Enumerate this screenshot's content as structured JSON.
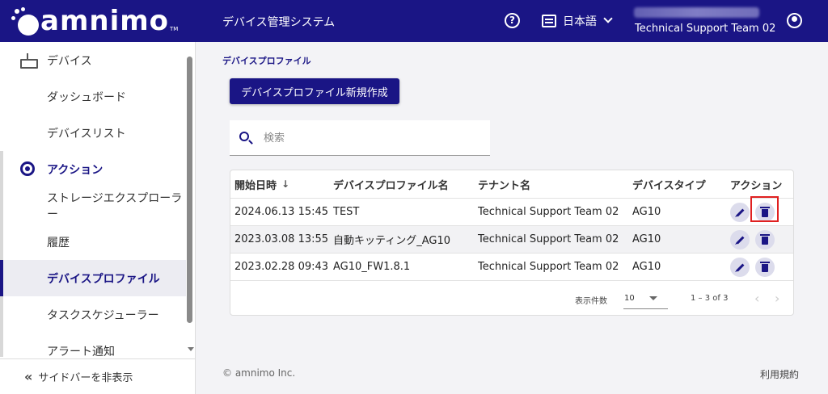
{
  "header": {
    "logo_text": "amnimo",
    "logo_tm": "TM",
    "app_title": "デバイス管理システム",
    "help_glyph": "?",
    "language": "日本語",
    "team_name": "Technical Support Team 02"
  },
  "sidebar": {
    "items": [
      {
        "label": "デバイス",
        "kind": "section-inactive",
        "icon": "router-icon"
      },
      {
        "label": "ダッシュボード",
        "kind": "sub"
      },
      {
        "label": "デバイスリスト",
        "kind": "sub"
      },
      {
        "label": "アクション",
        "kind": "section-active",
        "icon": "gear-icon"
      },
      {
        "label": "ストレージエクスプローラー",
        "kind": "sub"
      },
      {
        "label": "履歴",
        "kind": "sub"
      },
      {
        "label": "デバイスプロファイル",
        "kind": "active"
      },
      {
        "label": "タスクスケジューラー",
        "kind": "sub"
      },
      {
        "label": "アラート通知",
        "kind": "sub"
      }
    ],
    "collapse_icon": "«",
    "collapse_label": "サイドバーを非表示"
  },
  "main": {
    "breadcrumb": "デバイスプロファイル",
    "new_button_label": "デバイスプロファイル新規作成",
    "search": {
      "placeholder": "検索",
      "value": ""
    },
    "table": {
      "columns": [
        "開始日時",
        "デバイスプロファイル名",
        "テナント名",
        "デバイスタイプ",
        "アクション"
      ],
      "sort_indicator": "↓",
      "rows": [
        {
          "start": "2024.06.13 15:45",
          "name": "TEST",
          "tenant": "Technical Support Team 02",
          "type": "AG10"
        },
        {
          "start": "2023.03.08 13:55",
          "name": "自動キッティング_AG10",
          "tenant": "Technical Support Team 02",
          "type": "AG10"
        },
        {
          "start": "2023.02.28 09:43",
          "name": "AG10_FW1.8.1",
          "tenant": "Technical Support Team 02",
          "type": "AG10"
        }
      ]
    },
    "pagination": {
      "rows_label": "表示件数",
      "rows_value": "10",
      "range": "1 – 3 of 3",
      "prev": "‹",
      "next": "›"
    }
  },
  "footer": {
    "copyright": "© amnimo Inc.",
    "terms": "利用規約"
  },
  "colors": {
    "brand": "#1a1585",
    "highlight": "#e02020"
  }
}
